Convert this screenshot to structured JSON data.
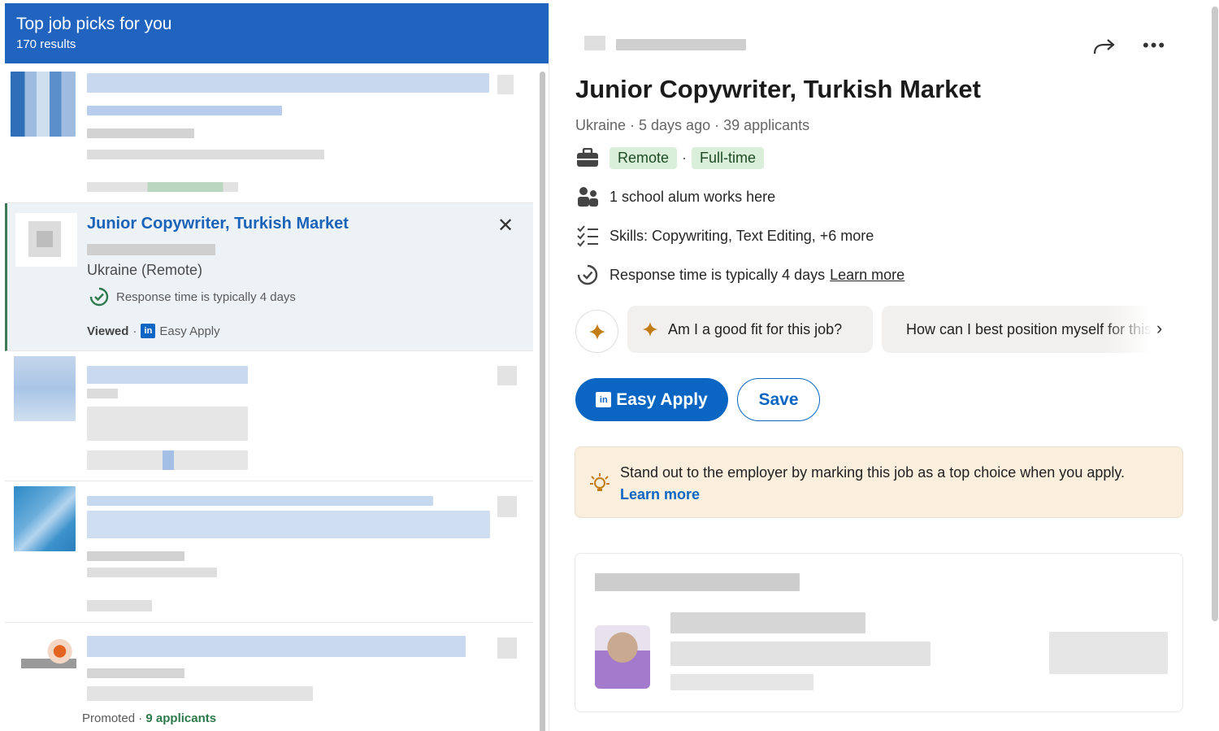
{
  "list_header": {
    "title": "Top job picks for you",
    "count": "170 results"
  },
  "selected_job": {
    "title": "Junior Copywriter, Turkish Market",
    "location": "Ukraine (Remote)",
    "response": "Response time is typically 4 days",
    "viewed": "Viewed",
    "separator": "·",
    "easy_apply": "Easy Apply"
  },
  "promoted_footer": {
    "promoted": "Promoted",
    "separator": "·",
    "applicants": "9 applicants"
  },
  "detail": {
    "title": "Junior Copywriter, Turkish Market",
    "meta": "Ukraine · 5 days ago · 39 applicants",
    "tags": [
      "Remote",
      "Full-time"
    ],
    "tag_separator": "·",
    "alumni": "1 school alum works here",
    "skills": "Skills: Copywriting, Text Editing, +6 more",
    "response": "Response time is typically 4 days",
    "learn_more": "Learn more",
    "ai_prompts": [
      "Am I a good fit for this job?",
      "How can I best position myself for this job?"
    ],
    "easy_apply_label": "Easy Apply",
    "save_label": "Save",
    "tip_text": "Stand out to the employer by marking this job as a top choice when you apply.",
    "tip_link": "Learn more",
    "more_menu": "•••"
  },
  "colors": {
    "header_bg": "#2164c0",
    "link_blue": "#0a66c2",
    "pill_green": "#daefd9",
    "tip_bg": "#faeedd",
    "spark": "#c37d16"
  },
  "icons": [
    "briefcase-icon",
    "people-icon",
    "checklist-icon",
    "response-clock-icon",
    "spark-icon",
    "share-icon",
    "more-icon",
    "close-icon",
    "lightbulb-icon",
    "chevron-right-icon",
    "linkedin-icon"
  ]
}
